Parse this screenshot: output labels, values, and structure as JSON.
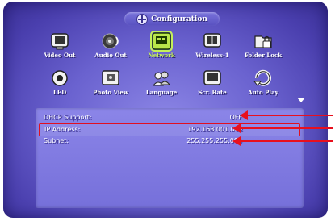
{
  "header": {
    "title": "Configuration"
  },
  "menu": {
    "row1": [
      {
        "label": "Video Out",
        "icon": "video-out-icon"
      },
      {
        "label": "Audio Out",
        "icon": "audio-out-icon"
      },
      {
        "label": "Network",
        "icon": "network-icon",
        "selected": true
      },
      {
        "label": "Wireless-1",
        "icon": "wireless-icon"
      },
      {
        "label": "Folder Lock",
        "icon": "folder-lock-icon"
      }
    ],
    "row2": [
      {
        "label": "LED",
        "icon": "led-icon"
      },
      {
        "label": "Photo View",
        "icon": "photo-view-icon"
      },
      {
        "label": "Language",
        "icon": "language-icon"
      },
      {
        "label": "Scr. Rate",
        "icon": "screen-rate-icon"
      },
      {
        "label": "Auto Play",
        "icon": "auto-play-icon"
      }
    ]
  },
  "network_info": {
    "dhcp": {
      "label": "DHCP Support:",
      "value": "OFF"
    },
    "ip": {
      "label": "IP Address:",
      "value": "192.168.001.002"
    },
    "subnet": {
      "label": "Subnet:",
      "value": "255.255.255.000"
    }
  },
  "colors": {
    "background": "#5a51c4",
    "panel": "#7e78df",
    "selected": "#c4f05a",
    "annotation": "#e8101e"
  }
}
